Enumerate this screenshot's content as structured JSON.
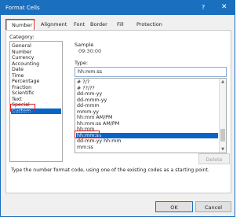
{
  "window": {
    "title": "Format Cells",
    "help": "?",
    "close": "✕"
  },
  "tabs": [
    {
      "label": "Number"
    },
    {
      "label": "Alignment"
    },
    {
      "label": "Font"
    },
    {
      "label": "Border"
    },
    {
      "label": "Fill"
    },
    {
      "label": "Protection"
    }
  ],
  "category": {
    "label": "Category:",
    "items": [
      "General",
      "Number",
      "Currency",
      "Accounting",
      "Date",
      "Time",
      "Percentage",
      "Fraction",
      "Scientific",
      "Text",
      "Special",
      "Custom"
    ],
    "selected": "Custom"
  },
  "sample": {
    "label": "Sample",
    "value": "09:30:00"
  },
  "type": {
    "label": "Type:",
    "value": "hh:mm:ss",
    "list": [
      "# ?/?",
      "# ??/??",
      "dd-mm-yy",
      "dd-mmm-yy",
      "dd-mmm",
      "mmm-yy",
      "hh:mm AM/PM",
      "hh:mm:ss AM/PM",
      "hh:mm",
      "hh:mm:ss",
      "dd-mm-yy hh:mm",
      "mm:ss"
    ],
    "selected": "hh:mm:ss"
  },
  "buttons": {
    "delete": "Delete",
    "ok": "OK",
    "cancel": "Cancel"
  },
  "hint": "Type the number format code, using one of the existing codes as a starting point."
}
